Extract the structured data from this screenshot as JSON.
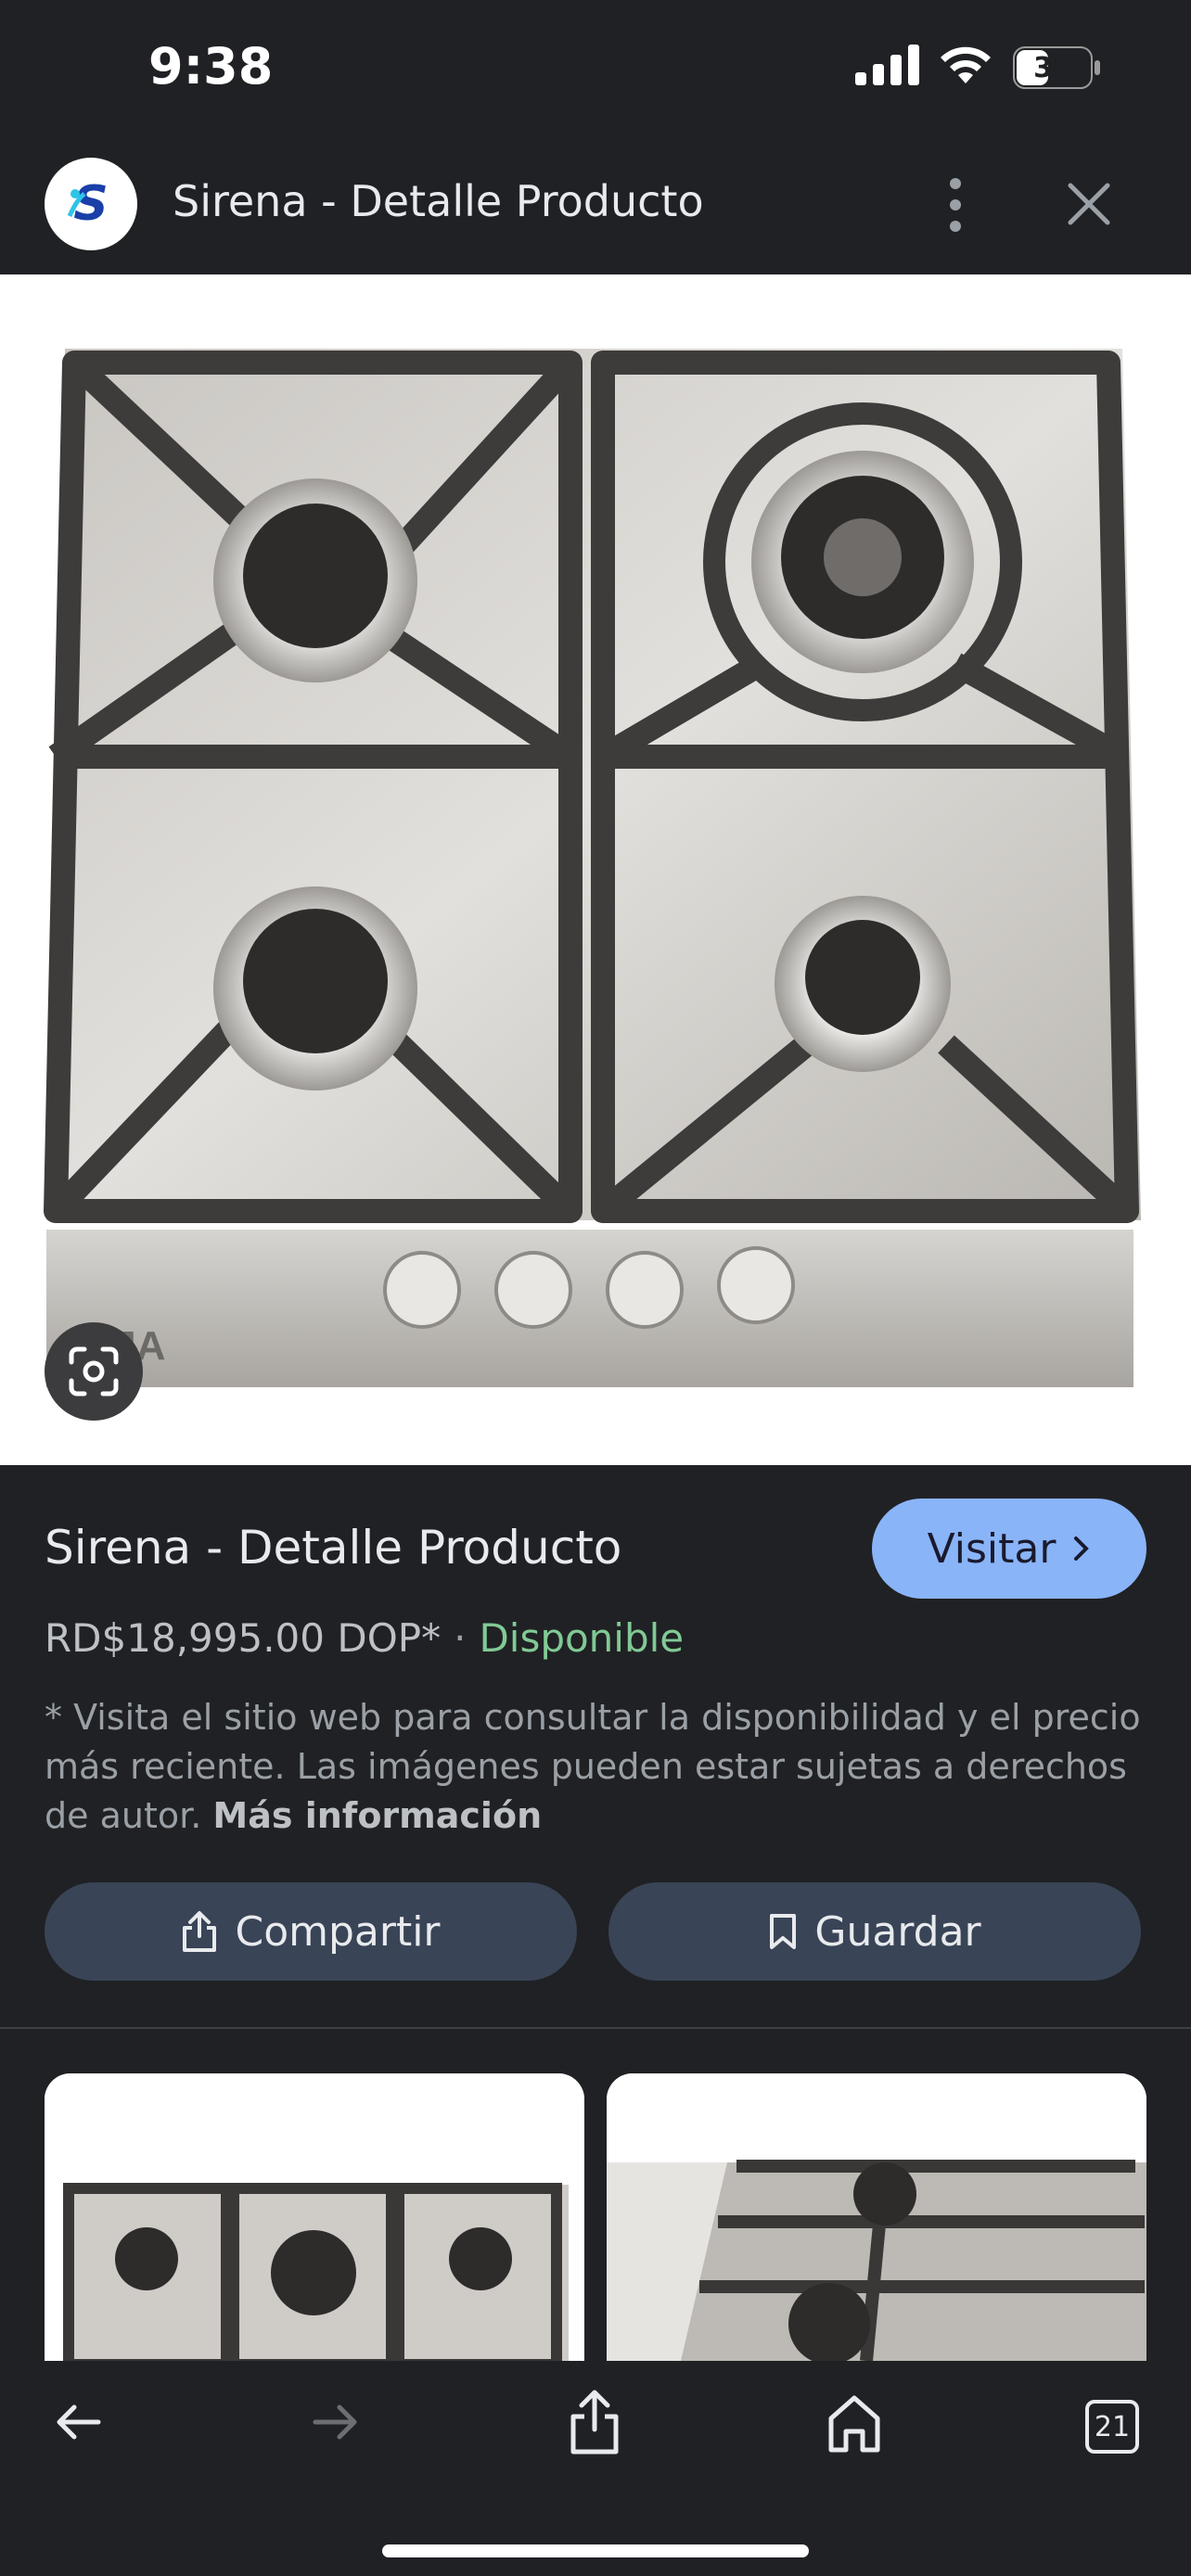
{
  "status_bar": {
    "time": "9:38",
    "battery_level": "38"
  },
  "header": {
    "title": "Sirena - Detalle Producto",
    "logo_icon": "sirena-logo-icon"
  },
  "product": {
    "title": "Sirena - Detalle Producto",
    "visit_label": "Visitar",
    "price": "RD$18,995.00 DOP*",
    "separator": "·",
    "availability": "Disponible",
    "disclaimer": "* Visita el sitio web para consultar la disponibilidad y el precio más reciente. Las imágenes pueden estar sujetas a derechos de autor.",
    "more_info": "Más información",
    "image_brand_text": "IJA"
  },
  "actions": {
    "share_label": "Compartir",
    "save_label": "Guardar"
  },
  "toolbar": {
    "tabs_count": "21"
  },
  "colors": {
    "background": "#202124",
    "visit_button": "#8ab4f8",
    "availability": "#81c995",
    "action_button": "#394457"
  }
}
